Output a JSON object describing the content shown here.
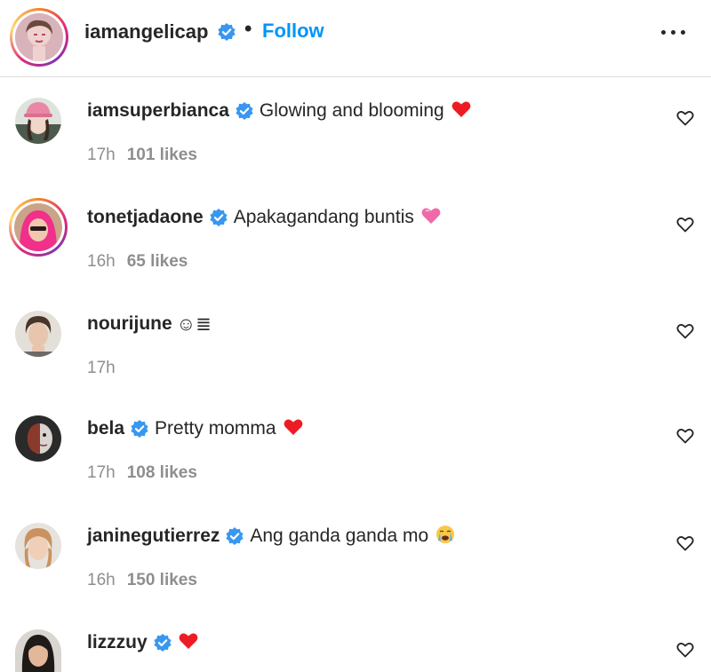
{
  "post_header": {
    "username": "iamangelicap",
    "separator": "•",
    "follow_label": "Follow",
    "more_icon": "more-horizontal-icon"
  },
  "comments": [
    {
      "username": "iamsuperbianca",
      "verified": true,
      "text": "Glowing and blooming",
      "emoji": "red-heart",
      "time": "17h",
      "likes": "101 likes"
    },
    {
      "username": "tonetjadaone",
      "verified": true,
      "text": "Apakagandang buntis",
      "emoji": "pink-heart",
      "time": "16h",
      "likes": "65 likes"
    },
    {
      "username": "nourijune",
      "verified": false,
      "text": "☺≣",
      "emoji": "",
      "time": "17h",
      "likes": ""
    },
    {
      "username": "bela",
      "verified": true,
      "text": "Pretty momma",
      "emoji": "red-heart",
      "time": "17h",
      "likes": "108 likes"
    },
    {
      "username": "janinegutierrez",
      "verified": true,
      "text": "Ang ganda ganda mo",
      "emoji": "crying-face",
      "time": "16h",
      "likes": "150 likes"
    },
    {
      "username": "lizzzuy",
      "verified": true,
      "text": "",
      "emoji": "red-heart",
      "time": "",
      "likes": ""
    }
  ],
  "colors": {
    "accent_blue": "#0095f6",
    "verified_blue": "#3897f0",
    "heart_red": "#ed1c24",
    "muted_text": "#8e8e8e"
  }
}
